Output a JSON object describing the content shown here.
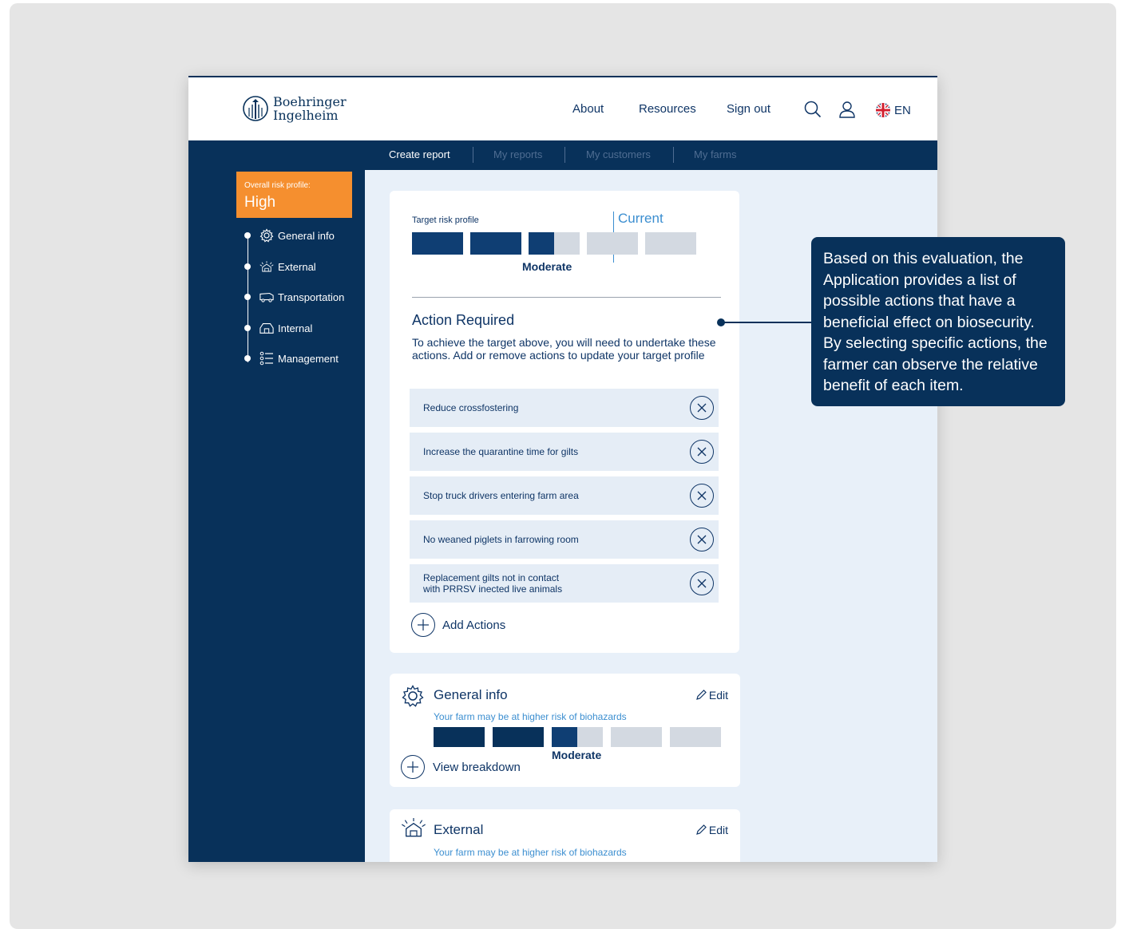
{
  "header": {
    "logo_line1": "Boehringer",
    "logo_line2": "Ingelheim",
    "nav": [
      "About",
      "Resources",
      "Sign out"
    ],
    "icons": [
      "search-icon",
      "user-icon"
    ],
    "language": "EN"
  },
  "subnav": {
    "items": [
      "Create report",
      "My reports",
      "My customers",
      "My farms"
    ],
    "active": "Create report"
  },
  "sidebar": {
    "risk_label": "Overall risk profile:",
    "risk_value": "High",
    "items": [
      {
        "label": "General info",
        "icon": "gear-icon"
      },
      {
        "label": "External",
        "icon": "farm-sun-icon"
      },
      {
        "label": "Transportation",
        "icon": "truck-icon"
      },
      {
        "label": "Internal",
        "icon": "barn-icon"
      },
      {
        "label": "Management",
        "icon": "list-icon"
      }
    ]
  },
  "target": {
    "label": "Target risk profile",
    "current_label": "Current",
    "level": "Moderate",
    "segments_filled": 2.5,
    "segments_total": 5
  },
  "actions": {
    "title": "Action Required",
    "description": "To achieve the target above, you will need to undertake these actions. Add or remove actions to update your target profile",
    "items": [
      "Reduce crossfostering",
      "Increase the quarantine time for gilts",
      "Stop truck drivers entering farm area",
      "No weaned piglets in farrowing room",
      "Replacement gilts not in contact\nwith PRRSV inected live animals"
    ],
    "add_label": "Add Actions"
  },
  "sections": [
    {
      "title": "General info",
      "icon": "gear-icon",
      "edit_label": "Edit",
      "warning": "Your farm may be at higher risk of biohazards",
      "level": "Moderate",
      "segments_filled": 2.5,
      "segments_total": 5,
      "breakdown_label": "View breakdown"
    },
    {
      "title": "External",
      "icon": "farm-sun-icon",
      "edit_label": "Edit",
      "warning": "Your farm may be at higher risk of biohazards"
    }
  ],
  "callout": {
    "text": "Based on this evaluation, the Application provides a list of possible actions that have a beneficial effect on biosecurity. By selecting specific actions, the farmer can observe the relative benefit of each item."
  },
  "colors": {
    "navy": "#08315a",
    "orange": "#f58f2f",
    "light_blue_bg": "#e8f0f9",
    "accent_blue": "#3b8ed0",
    "segment_filled": "#0f3e73",
    "segment_empty": "#d3d9e1"
  }
}
